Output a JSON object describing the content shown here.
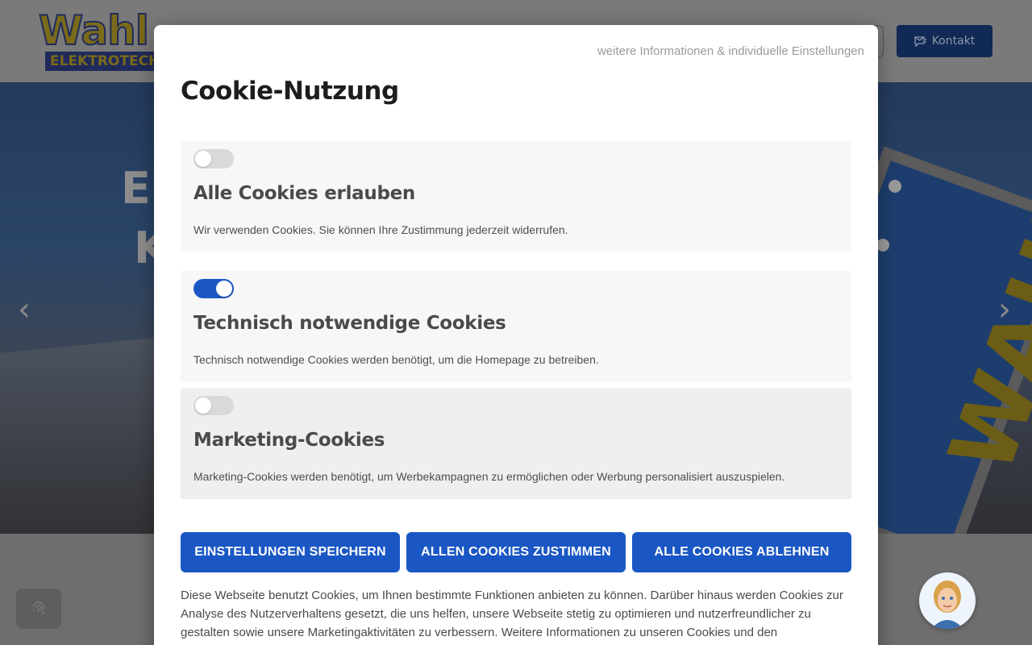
{
  "header": {
    "logo_top": "Wahl",
    "logo_bottom": "ELEKTROTECHNIK",
    "kontakt_label": "Kontakt"
  },
  "hero": {
    "title_line1": "El",
    "title_line2": "K",
    "sign_text": "WAHL"
  },
  "cookie_modal": {
    "more_link": "weitere Informationen & individuelle Einstellungen",
    "title": "Cookie-Nutzung",
    "categories": [
      {
        "title": "Alle Cookies erlauben",
        "description": "Wir verwenden Cookies. Sie können Ihre Zustimmung jederzeit widerrufen.",
        "enabled": false
      },
      {
        "title": "Technisch notwendige Cookies",
        "description": "Technisch notwendige Cookies werden benötigt, um die Homepage zu betreiben.",
        "enabled": true
      },
      {
        "title": "Marketing-Cookies",
        "description": "Marketing-Cookies werden benötigt, um Werbekampagnen zu ermöglichen oder Werbung personalisiert auszuspielen.",
        "enabled": false
      }
    ],
    "buttons": {
      "save": "EINSTELLUNGEN SPEICHERN",
      "accept_all": "ALLEN COOKIES ZUSTIMMEN",
      "reject_all": "ALLE COOKIES ABLEHNEN"
    },
    "body_text": "Diese Webseite benutzt Cookies, um Ihnen bestimmte Funktionen anbieten zu können. Darüber hinaus werden Cookies zur Analyse des Nutzerverhaltens gesetzt, die uns helfen, unsere Webseite stetig zu optimieren und nutzerfreundlicher zu gestalten sowie unsere Marketingaktivitäten zu verbessern. Weitere Informationen zu unseren Cookies und den"
  },
  "colors": {
    "primary_blue": "#1a57c4",
    "toggle_off": "#d9d9d9",
    "overlay_bg": "#6b6b6b"
  }
}
